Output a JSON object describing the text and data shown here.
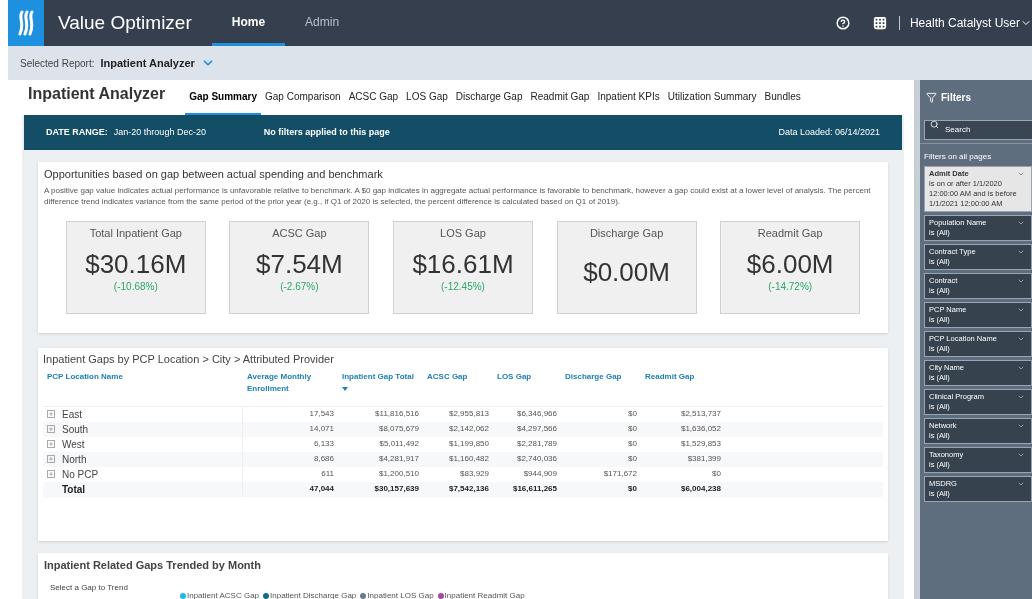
{
  "app": {
    "title": "Value Optimizer",
    "nav": [
      {
        "label": "Home",
        "selected": true
      },
      {
        "label": "Admin",
        "selected": false
      }
    ],
    "user": "Health Catalyst User"
  },
  "selected_report": {
    "label": "Selected Report:",
    "value": "Inpatient Analyzer"
  },
  "report": {
    "title": "Inpatient Analyzer",
    "tabs": [
      {
        "label": "Gap Summary",
        "selected": true
      },
      {
        "label": "Gap Comparison",
        "selected": false
      },
      {
        "label": "ACSC Gap",
        "selected": false
      },
      {
        "label": "LOS Gap",
        "selected": false
      },
      {
        "label": "Discharge Gap",
        "selected": false
      },
      {
        "label": "Readmit Gap",
        "selected": false
      },
      {
        "label": "Inpatient KPIs",
        "selected": false
      },
      {
        "label": "Utilization Summary",
        "selected": false
      },
      {
        "label": "Bundles",
        "selected": false
      }
    ]
  },
  "banner": {
    "date_label": "DATE RANGE:",
    "date_value": "Jan-20 through Dec-20",
    "filters_note": "No filters applied to this page",
    "data_loaded": "Data Loaded: 06/14/2021"
  },
  "opportunities": {
    "title": "Opportunities based on gap between actual spending and benchmark",
    "description": "A positive gap value indicates actual performance is unfavorable relative to benchmark. A $0 gap indicates in aggregate actual performance is favorable to benchmark, however a gap could exist at a lower level of analysis. The percent difference trend indicates variance from the same period of the prior year (e.g., if Q1 of 2020 is selected, the percent difference is calculated based on Q1 of 2019).",
    "kpis": [
      {
        "label": "Total Inpatient Gap",
        "value": "$30.16M",
        "change": "(-10.68%)"
      },
      {
        "label": "ACSC Gap",
        "value": "$7.54M",
        "change": "(-2.67%)"
      },
      {
        "label": "LOS Gap",
        "value": "$16.61M",
        "change": "(-12.45%)"
      },
      {
        "label": "Discharge Gap",
        "value": "$0.00M"
      },
      {
        "label": "Readmit Gap",
        "value": "$6.00M",
        "change": "(-14.72%)"
      }
    ]
  },
  "gap_table": {
    "title": "Inpatient Gaps by PCP Location > City > Attributed Provider",
    "columns": [
      {
        "label": "PCP Location Name",
        "sorted": false
      },
      {
        "label": "Average Monthly Enrollment",
        "sorted": false
      },
      {
        "label": "Inpatient Gap Total",
        "sorted": true
      },
      {
        "label": "ACSC Gap",
        "sorted": false
      },
      {
        "label": "LOS Gap",
        "sorted": false
      },
      {
        "label": "Discharge Gap",
        "sorted": false
      },
      {
        "label": "Readmit Gap",
        "sorted": false
      }
    ],
    "rows": [
      [
        "East",
        "17,543",
        "$11,816,516",
        "$2,955,813",
        "$6,346,966",
        "$0",
        "$2,513,737"
      ],
      [
        "South",
        "14,071",
        "$8,075,679",
        "$2,142,062",
        "$4,297,566",
        "$0",
        "$1,636,052"
      ],
      [
        "West",
        "6,133",
        "$5,011,492",
        "$1,199,850",
        "$2,281,789",
        "$0",
        "$1,529,853"
      ],
      [
        "North",
        "8,686",
        "$4,281,917",
        "$1,160,482",
        "$2,740,036",
        "$0",
        "$381,399"
      ],
      [
        "No PCP",
        "611",
        "$1,200,510",
        "$83,929",
        "$944,909",
        "$171,672",
        "$0"
      ]
    ],
    "total": [
      "Total",
      "47,044",
      "$30,157,639",
      "$7,542,136",
      "$16,611,265",
      "$0",
      "$6,004,238"
    ]
  },
  "trend": {
    "title": "Inpatient Related Gaps Trended by Month",
    "selector_label": "Select a Gap to Trend",
    "legend": [
      {
        "label": "Inpatient ACSC Gap",
        "color": "#22b5f0"
      },
      {
        "label": "Inpatient Discharge Gap",
        "color": "#146c8c"
      },
      {
        "label": "Inpatient LOS Gap",
        "color": "#6b7c8c"
      },
      {
        "label": "Inpatient Readmit Gap",
        "color": "#a349a4"
      }
    ]
  },
  "filters": {
    "title": "Filters",
    "search_placeholder": "Search",
    "section": "Filters on all pages",
    "items": [
      {
        "name": "Admit Date",
        "value": "is on or after 1/1/2020 12:00:00 AM and is before 1/1/2021 12:00:00 AM",
        "applied": true
      },
      {
        "name": "Population Name",
        "value": "is (All)",
        "applied": false
      },
      {
        "name": "Contract Type",
        "value": "is (All)",
        "applied": false
      },
      {
        "name": "Contract",
        "value": "is (All)",
        "applied": false
      },
      {
        "name": "PCP Name",
        "value": "is (All)",
        "applied": false
      },
      {
        "name": "PCP Location Name",
        "value": "is (All)",
        "applied": false
      },
      {
        "name": "City Name",
        "value": "is (All)",
        "applied": false
      },
      {
        "name": "Clinical Program",
        "value": "is (All)",
        "applied": false
      },
      {
        "name": "Network",
        "value": "is (All)",
        "applied": false
      },
      {
        "name": "Taxonomy",
        "value": "is (All)",
        "applied": false
      },
      {
        "name": "MSDRG",
        "value": "is (All)",
        "applied": false
      }
    ]
  }
}
